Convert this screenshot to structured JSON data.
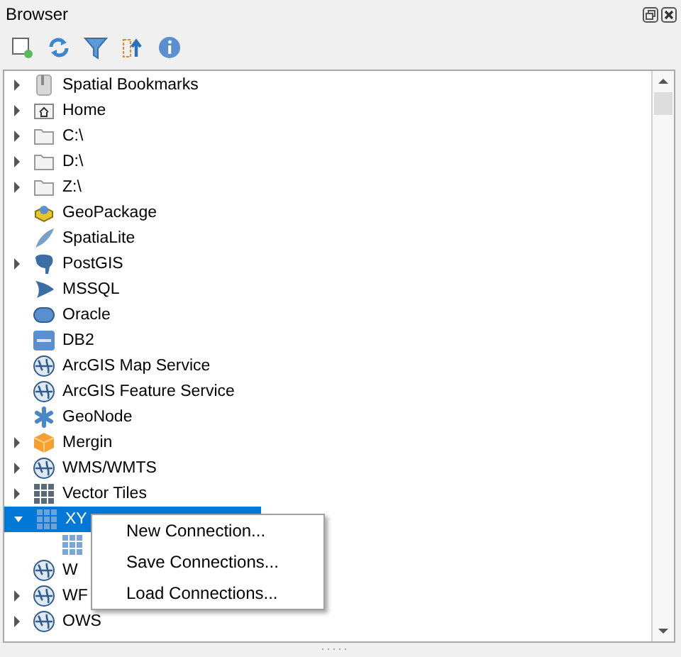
{
  "panel": {
    "title": "Browser",
    "toolbar": [
      {
        "kind": "add"
      },
      {
        "kind": "refresh"
      },
      {
        "kind": "filter"
      },
      {
        "kind": "collapse"
      },
      {
        "kind": "info"
      }
    ]
  },
  "tree": [
    {
      "label": "Spatial Bookmarks",
      "kind": "bookmarks",
      "expandable": true,
      "expanded": false,
      "selected": false
    },
    {
      "label": "Home",
      "kind": "home",
      "expandable": true,
      "expanded": false,
      "selected": false
    },
    {
      "label": "C:\\",
      "kind": "folder",
      "expandable": true,
      "expanded": false,
      "selected": false
    },
    {
      "label": "D:\\",
      "kind": "folder",
      "expandable": true,
      "expanded": false,
      "selected": false
    },
    {
      "label": "Z:\\",
      "kind": "folder",
      "expandable": true,
      "expanded": false,
      "selected": false
    },
    {
      "label": "GeoPackage",
      "kind": "geopackage",
      "expandable": false,
      "selected": false
    },
    {
      "label": "SpatiaLite",
      "kind": "feather",
      "expandable": false,
      "selected": false
    },
    {
      "label": "PostGIS",
      "kind": "elephant",
      "expandable": true,
      "expanded": false,
      "selected": false
    },
    {
      "label": "MSSQL",
      "kind": "mssql",
      "expandable": false,
      "selected": false
    },
    {
      "label": "Oracle",
      "kind": "oracle",
      "expandable": false,
      "selected": false
    },
    {
      "label": "DB2",
      "kind": "db2",
      "expandable": false,
      "selected": false
    },
    {
      "label": "ArcGIS Map Service",
      "kind": "globe",
      "expandable": false,
      "selected": false
    },
    {
      "label": "ArcGIS Feature Service",
      "kind": "globe",
      "expandable": false,
      "selected": false
    },
    {
      "label": "GeoNode",
      "kind": "geonode",
      "expandable": false,
      "selected": false
    },
    {
      "label": "Mergin",
      "kind": "cube",
      "expandable": true,
      "expanded": false,
      "selected": false
    },
    {
      "label": "WMS/WMTS",
      "kind": "globe",
      "expandable": true,
      "expanded": false,
      "selected": false
    },
    {
      "label": "Vector Tiles",
      "kind": "grid",
      "expandable": true,
      "expanded": false,
      "selected": false
    },
    {
      "label": "XY",
      "kind": "grid",
      "expandable": true,
      "expanded": true,
      "selected": true,
      "children": [
        {
          "kind": "grid",
          "expandable": false,
          "selected": false
        }
      ]
    },
    {
      "label": "W",
      "kind": "globe",
      "expandable": false,
      "selected": false
    },
    {
      "label": "WF",
      "kind": "globe",
      "expandable": true,
      "expanded": false,
      "selected": false
    },
    {
      "label": "OWS",
      "kind": "globe",
      "expandable": true,
      "expanded": false,
      "selected": false
    }
  ],
  "context_menu": {
    "items": [
      "New Connection...",
      "Save Connections...",
      "Load Connections..."
    ]
  }
}
